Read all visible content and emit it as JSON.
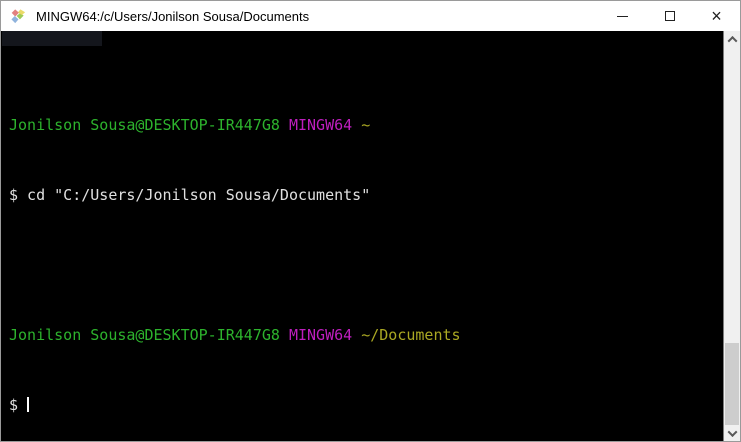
{
  "window": {
    "title": "MINGW64:/c/Users/Jonilson Sousa/Documents",
    "controls": {
      "close_glyph": "×"
    }
  },
  "terminal": {
    "prompt_line_1": {
      "user_host": "Jonilson Sousa@DESKTOP-IR447G8",
      "env": "MINGW64",
      "path": "~"
    },
    "command_1": "$ cd \"C:/Users/Jonilson Sousa/Documents\"",
    "prompt_line_2": {
      "user_host": "Jonilson Sousa@DESKTOP-IR447G8",
      "env": "MINGW64",
      "path": "~/Documents"
    },
    "prompt_symbol": "$"
  },
  "colors": {
    "terminal_background": "#000000",
    "terminal_foreground": "#e0e0e0",
    "prompt_green": "#2db32d",
    "env_magenta": "#be1ebe",
    "path_yellow": "#aaa823",
    "titlebar_background": "#ffffff",
    "titlebar_text": "#000000",
    "scrollbar_track": "#f0f0f0",
    "scrollbar_thumb": "#cdcdcd"
  },
  "icons": {
    "app": "git-bash-diamond",
    "minimize": "minimize-dash",
    "maximize": "maximize-square",
    "close": "close-x",
    "scroll_up": "chevron-up",
    "scroll_down": "chevron-down"
  }
}
